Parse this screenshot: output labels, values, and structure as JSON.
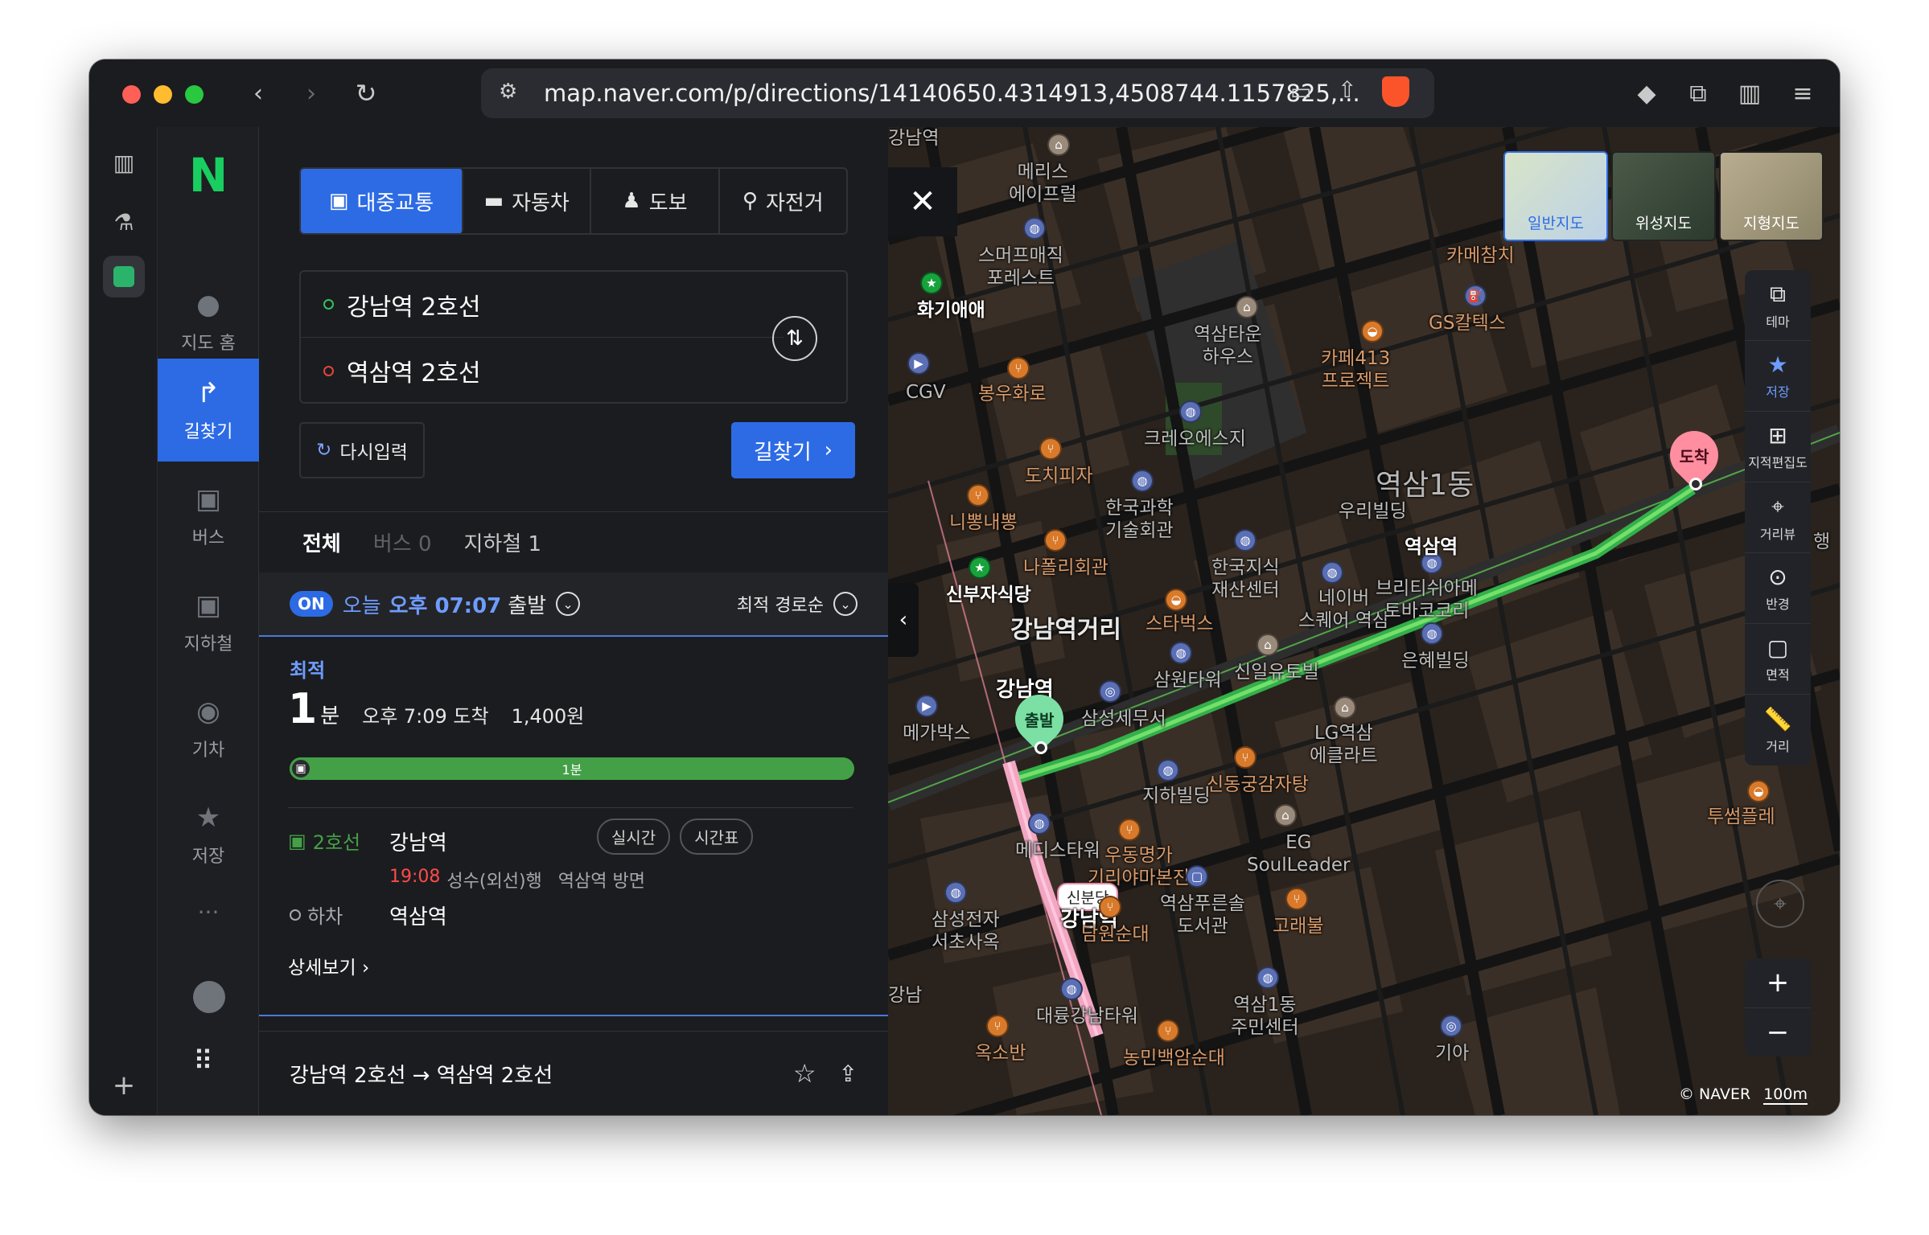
{
  "browser": {
    "url": "map.naver.com/p/directions/14140650.4314913,4508744.1157825,...",
    "colors": {
      "close": "#fe5f57",
      "minimize": "#febc2e",
      "maximize": "#28c840"
    }
  },
  "nav": {
    "logo": "N",
    "items": [
      {
        "label": "지도 홈",
        "icon": "map-pin-icon"
      },
      {
        "label": "길찾기",
        "icon": "directions-icon"
      },
      {
        "label": "버스",
        "icon": "bus-icon"
      },
      {
        "label": "지하철",
        "icon": "subway-icon"
      },
      {
        "label": "기차",
        "icon": "train-icon"
      },
      {
        "label": "저장",
        "icon": "star-icon"
      }
    ],
    "more": "···"
  },
  "panel": {
    "modes": [
      {
        "label": "대중교통",
        "icon": "bus-icon"
      },
      {
        "label": "자동차",
        "icon": "car-icon"
      },
      {
        "label": "도보",
        "icon": "walk-icon"
      },
      {
        "label": "자전거",
        "icon": "bike-icon"
      }
    ],
    "origin": "강남역 2호선",
    "destination": "역삼역 2호선",
    "reset_label": "다시입력",
    "find_label": "길찾기",
    "tabs": [
      {
        "label": "전체"
      },
      {
        "label": "버스 0"
      },
      {
        "label": "지하철 1"
      }
    ],
    "departure": {
      "on": "ON",
      "day": "오늘",
      "time": "오후 07:07",
      "suffix": "출발",
      "sort": "최적 경로순"
    },
    "route": {
      "tag": "최적",
      "minutes": "1",
      "unit": "분",
      "arrival": "오후 7:09 도착",
      "fare": "1,400원",
      "bar_label": "1분",
      "line": "2호선",
      "board_station": "강남역",
      "realtime": "실시간",
      "timetable": "시간표",
      "dep_time": "19:08",
      "direction": "성수(외선)행",
      "platform": "역삼역 방면",
      "alight_label": "하차",
      "alight_station": "역삼역",
      "detail": "상세보기"
    },
    "footer": "강남역 2호선 → 역삼역 2호선"
  },
  "map": {
    "layers": [
      "일반지도",
      "위성지도",
      "지형지도"
    ],
    "tools": [
      {
        "label": "테마",
        "icon": "layers-icon"
      },
      {
        "label": "저장",
        "icon": "star-icon"
      },
      {
        "label": "지적편집도",
        "icon": "grid-icon"
      },
      {
        "label": "거리뷰",
        "icon": "pin-icon"
      },
      {
        "label": "반경",
        "icon": "radius-icon"
      },
      {
        "label": "면적",
        "icon": "area-icon"
      },
      {
        "label": "거리",
        "icon": "ruler-icon"
      }
    ],
    "start_badge": "출발",
    "end_badge": "도착",
    "copyright": "© NAVER",
    "scale": "100m",
    "labels": {
      "l1": "메리스\n에이프럴",
      "l2": "스머프매직\n포레스트",
      "l3": "화기애애",
      "l4": "CGV",
      "l5": "봉우화로",
      "l6": "역삼타운\n하우스",
      "l7": "카페413\n프로젝트",
      "l8": "GS칼텍스",
      "l9": "카메참치",
      "l10": "크레오에스지",
      "l11": "도치피자",
      "l12": "니뽕내뽕",
      "l13": "한국과학\n기술회관",
      "l14": "나폴리회관",
      "l15": "한국지식\n재산센터",
      "l16": "신부자식당",
      "l17": "강남역거리",
      "l18": "스타벅스",
      "l19": "네이버\n스퀘어 역삼",
      "l20": "브리티쉬아메\n토바코코리",
      "l21": "삼원타워",
      "l22": "신일유토빌",
      "l23": "강남역",
      "l24": "삼성세무서",
      "l25": "메가박스",
      "l26": "LG역삼\n에클라트",
      "l27": "신동궁감자탕",
      "l28": "지하빌딩",
      "l29": "은혜빌딩",
      "l30": "EG\nSoulLeader",
      "l31": "메디스타워",
      "l32": "우동명가\n기리야마본진",
      "l33": "신분당",
      "l34": "강남역",
      "l35": "삼성전자\n서초사옥",
      "l36": "역삼푸른솔\n도서관",
      "l37": "담원순대",
      "l38": "고래불",
      "l39": "대륭강남타워",
      "l40": "역삼1동\n주민센터",
      "l41": "옥소반",
      "l42": "농민백암순대",
      "l43": "기아",
      "l44": "역삼1동",
      "l45": "역삼역",
      "l46": "투썸플레",
      "l47": "강남",
      "l48": "우리빌딩",
      "l49": "강남역",
      "l50": "행"
    }
  }
}
